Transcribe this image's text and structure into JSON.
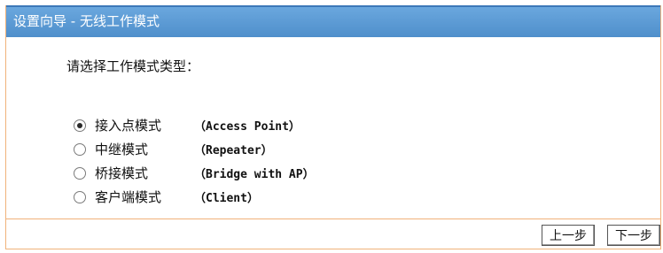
{
  "window": {
    "title": "设置向导 - 无线工作模式"
  },
  "prompt": "请选择工作模式类型：",
  "modes": [
    {
      "label": "接入点模式",
      "detail": "（Access Point）",
      "selected": true
    },
    {
      "label": "中继模式",
      "detail": "（Repeater）",
      "selected": false
    },
    {
      "label": "桥接模式",
      "detail": "（Bridge with AP）",
      "selected": false
    },
    {
      "label": "客户端模式",
      "detail": "（Client）",
      "selected": false
    }
  ],
  "buttons": {
    "prev": "上一步",
    "next": "下一步"
  },
  "colors": {
    "titlebar": "#5b9bd5",
    "border": "#f0b27a"
  }
}
